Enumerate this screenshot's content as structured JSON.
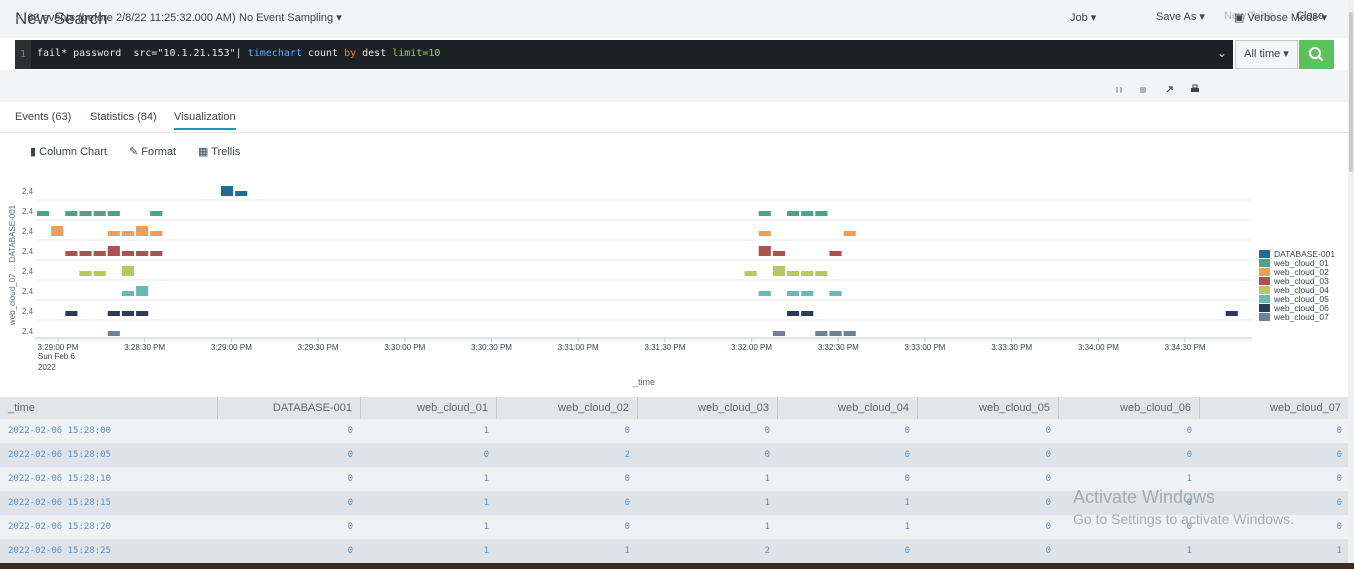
{
  "header": {
    "title": "New Search",
    "save_as": "Save As ▾",
    "new_table": "New Table",
    "close": "Close"
  },
  "search": {
    "line_number": "1",
    "query_parts": [
      {
        "text": "fail* password  src=\"10.1.21.153\"| ",
        "color": "#e8e8e8"
      },
      {
        "text": "timechart",
        "color": "#5ea6ff"
      },
      {
        "text": " count ",
        "color": "#e8e8e8"
      },
      {
        "text": "by",
        "color": "#f58220"
      },
      {
        "text": " dest ",
        "color": "#e8e8e8"
      },
      {
        "text": "limit=10",
        "color": "#9ad34e"
      }
    ],
    "time_range": "All time ▾"
  },
  "status": {
    "events": "63 events (before 2/8/22 11:25:32.000 AM)",
    "sampling": "No Event Sampling ▾",
    "job": "Job ▾",
    "mode": "Verbose Mode ▾"
  },
  "tabs": [
    {
      "label": "Events (63)"
    },
    {
      "label": "Statistics (84)"
    },
    {
      "label": "Visualization"
    }
  ],
  "viz_toolbar": {
    "chart_type": "Column Chart",
    "format": "Format",
    "trellis": "Trellis"
  },
  "chart_data": {
    "type": "bar",
    "xlabel": "_time",
    "ylabel": "web_cloud_07 ... DATABASE-001",
    "x_ticks": [
      "3:29:00 PM",
      "3:28:30 PM",
      "3:29:00 PM",
      "3:29:30 PM",
      "3:30:00 PM",
      "3:30:30 PM",
      "3:31:00 PM",
      "3:31:30 PM",
      "3:32:00 PM",
      "3:32:30 PM",
      "3:33:00 PM",
      "3:33:30 PM",
      "3:34:00 PM",
      "3:34:30 PM"
    ],
    "x_sub": [
      "Sun Feb 6",
      "2022"
    ],
    "y_tick": "2.4",
    "series": [
      {
        "name": "DATABASE-001",
        "color": "#1e6f8f",
        "values": [
          [
            13,
            2
          ],
          [
            14,
            1
          ]
        ]
      },
      {
        "name": "web_cloud_01",
        "color": "#4aa38a",
        "values": [
          [
            0,
            1
          ],
          [
            2,
            1
          ],
          [
            3,
            1
          ],
          [
            4,
            1
          ],
          [
            5,
            1
          ],
          [
            8,
            1
          ],
          [
            51,
            1
          ],
          [
            53,
            1
          ],
          [
            54,
            1
          ],
          [
            55,
            1
          ]
        ]
      },
      {
        "name": "web_cloud_02",
        "color": "#ee9e58",
        "values": [
          [
            1,
            2
          ],
          [
            5,
            1
          ],
          [
            6,
            1
          ],
          [
            7,
            2
          ],
          [
            8,
            1
          ],
          [
            51,
            1
          ],
          [
            57,
            1
          ]
        ]
      },
      {
        "name": "web_cloud_03",
        "color": "#b0504f",
        "values": [
          [
            2,
            1
          ],
          [
            3,
            1
          ],
          [
            4,
            1
          ],
          [
            5,
            2
          ],
          [
            6,
            1
          ],
          [
            7,
            1
          ],
          [
            8,
            1
          ],
          [
            51,
            2
          ],
          [
            52,
            1
          ],
          [
            56,
            1
          ]
        ]
      },
      {
        "name": "web_cloud_04",
        "color": "#b7c95f",
        "values": [
          [
            3,
            1
          ],
          [
            4,
            1
          ],
          [
            6,
            2
          ],
          [
            50,
            1
          ],
          [
            52,
            2
          ],
          [
            53,
            1
          ],
          [
            54,
            1
          ],
          [
            55,
            1
          ]
        ]
      },
      {
        "name": "web_cloud_05",
        "color": "#68b8ba",
        "values": [
          [
            6,
            1
          ],
          [
            7,
            2
          ],
          [
            51,
            1
          ],
          [
            53,
            1
          ],
          [
            54,
            1
          ],
          [
            56,
            1
          ]
        ]
      },
      {
        "name": "web_cloud_06",
        "color": "#293d5a",
        "values": [
          [
            2,
            1
          ],
          [
            5,
            1
          ],
          [
            6,
            1
          ],
          [
            7,
            1
          ],
          [
            53,
            1
          ],
          [
            54,
            1
          ],
          [
            84,
            1
          ]
        ]
      },
      {
        "name": "web_cloud_07",
        "color": "#6d8094",
        "values": [
          [
            5,
            1
          ],
          [
            52,
            1
          ],
          [
            55,
            1
          ],
          [
            56,
            1
          ],
          [
            57,
            1
          ]
        ]
      }
    ]
  },
  "table": {
    "columns": [
      "_time",
      "DATABASE-001",
      "web_cloud_01",
      "web_cloud_02",
      "web_cloud_03",
      "web_cloud_04",
      "web_cloud_05",
      "web_cloud_06",
      "web_cloud_07"
    ],
    "rows": [
      [
        "2022-02-06 15:28:00",
        "0",
        "1",
        "0",
        "0",
        "0",
        "0",
        "0",
        "0"
      ],
      [
        "2022-02-06 15:28:05",
        "0",
        "0",
        "2",
        "0",
        "0",
        "0",
        "0",
        "0"
      ],
      [
        "2022-02-06 15:28:10",
        "0",
        "1",
        "0",
        "1",
        "0",
        "0",
        "1",
        "0"
      ],
      [
        "2022-02-06 15:28:15",
        "0",
        "1",
        "0",
        "1",
        "1",
        "0",
        "0",
        "0"
      ],
      [
        "2022-02-06 15:28:20",
        "0",
        "1",
        "0",
        "1",
        "1",
        "0",
        "0",
        "0"
      ],
      [
        "2022-02-06 15:28:25",
        "0",
        "1",
        "1",
        "2",
        "0",
        "0",
        "1",
        "1"
      ]
    ]
  },
  "watermark": {
    "line1": "Activate Windows",
    "line2": "Go to Settings to activate Windows."
  }
}
